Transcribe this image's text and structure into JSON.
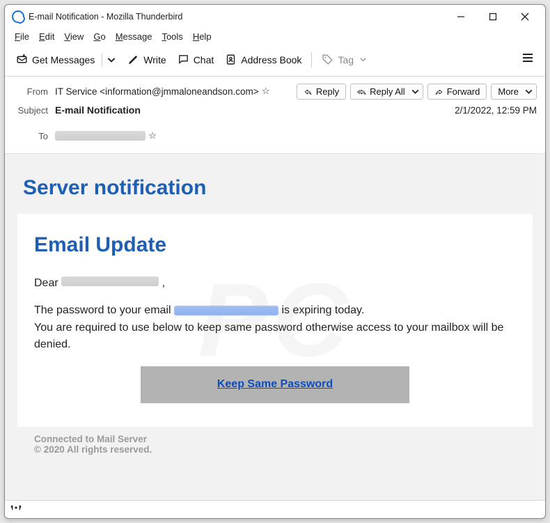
{
  "title": "E-mail Notification - Mozilla Thunderbird",
  "menus": {
    "file": "File",
    "edit": "Edit",
    "view": "View",
    "go": "Go",
    "message": "Message",
    "tools": "Tools",
    "help": "Help"
  },
  "toolbar": {
    "get": "Get Messages",
    "write": "Write",
    "chat": "Chat",
    "address": "Address Book",
    "tag": "Tag"
  },
  "actions": {
    "reply": "Reply",
    "replyall": "Reply All",
    "forward": "Forward",
    "more": "More"
  },
  "headers": {
    "from_label": "From",
    "from_value": "IT Service <information@jmmaloneandson.com>",
    "subject_label": "Subject",
    "subject_value": "E-mail Notification",
    "to_label": "To",
    "datetime": "2/1/2022, 12:59 PM"
  },
  "body": {
    "banner": "Server notification",
    "heading": "Email Update",
    "greeting_prefix": "Dear ",
    "greeting_suffix": " ,",
    "line_pre": "The password to your email ",
    "line_post": " is expiring today.",
    "line2": "You are required to use below to keep same password otherwise access to your mailbox will be denied.",
    "button": "Keep Same Password",
    "footer1": "Connected to  Mail Server",
    "footer2": "© 2020 All rights reserved."
  }
}
